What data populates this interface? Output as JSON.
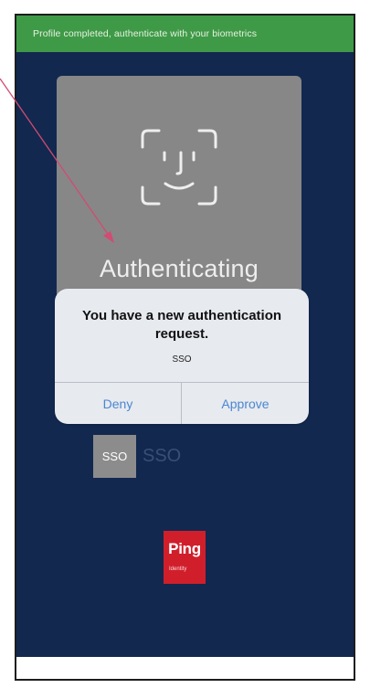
{
  "banner": {
    "text": "Profile completed, authenticate with your biometrics"
  },
  "auth_card": {
    "label": "Authenticating",
    "icon": "face-id-icon"
  },
  "alert": {
    "title": "You have a new authentication request.",
    "message": "SSO",
    "deny_label": "Deny",
    "approve_label": "Approve"
  },
  "app": {
    "tile_label": "SSO",
    "name": "SSO"
  },
  "logo": {
    "word": "Ping",
    "sub": "Identity"
  },
  "colors": {
    "banner": "#3f9a47",
    "background": "#12284f",
    "card": "#878787",
    "alert_button": "#4b86d1",
    "logo": "#d01f2b",
    "arrow": "#d24b72"
  }
}
